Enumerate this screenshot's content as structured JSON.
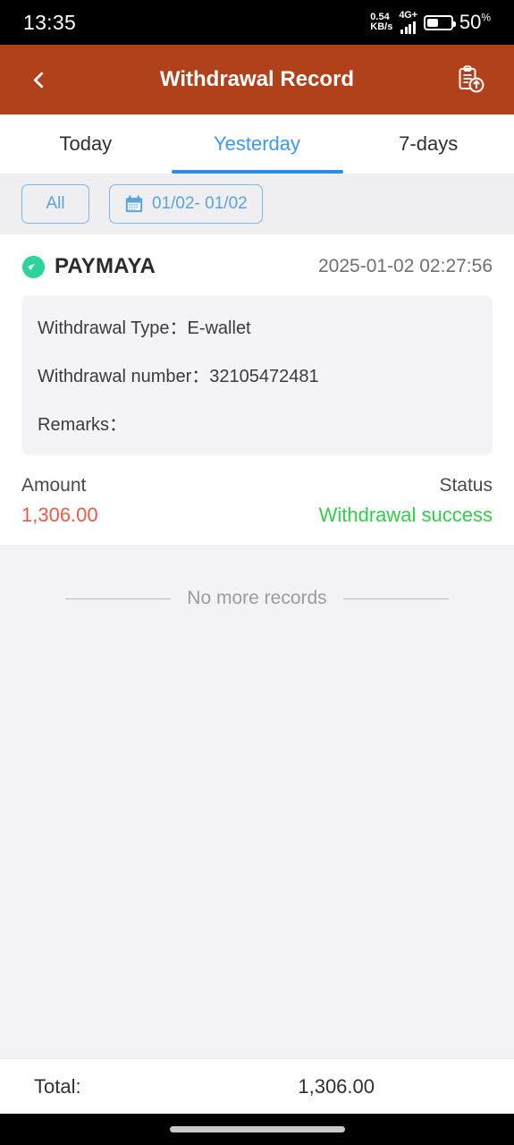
{
  "status_bar": {
    "time": "13:35",
    "net_speed_value": "0.54",
    "net_speed_unit": "KB/s",
    "network_type": "4G+",
    "data_arrows": "⇅",
    "battery_pct": "50",
    "battery_pct_symbol": "%",
    "battery_level": 50
  },
  "header": {
    "title": "Withdrawal Record",
    "back_icon": "chevron-left-icon",
    "export_icon": "clipboard-upload-icon",
    "bg_color": "#b0411a"
  },
  "tabs": {
    "items": [
      {
        "label": "Today",
        "active": false
      },
      {
        "label": "Yesterday",
        "active": true
      },
      {
        "label": "7-days",
        "active": false
      }
    ],
    "active_color": "#3d9ae8"
  },
  "filters": {
    "all_label": "All",
    "date_range": "01/02- 01/02",
    "calendar_icon": "calendar-icon",
    "accent_color": "#5ba3dd"
  },
  "record": {
    "brand": "PAYMAYA",
    "brand_icon": "paymaya-check-icon",
    "brand_icon_color": "#2ad49a",
    "timestamp": "2025-01-02 02:27:56",
    "details": [
      {
        "label": "Withdrawal Type：",
        "value": "E-wallet"
      },
      {
        "label": "Withdrawal number：",
        "value": "32105472481"
      },
      {
        "label": "Remarks：",
        "value": ""
      }
    ],
    "amount_label": "Amount",
    "amount_value": "1,306.00",
    "amount_color": "#ea5a4c",
    "status_label": "Status",
    "status_value": "Withdrawal success",
    "status_color": "#32cc4e"
  },
  "list_end": {
    "text": "No more records"
  },
  "footer": {
    "total_label": "Total:",
    "total_value": "1,306.00"
  },
  "nav_bar": {
    "home_indicator": "home-pill"
  }
}
